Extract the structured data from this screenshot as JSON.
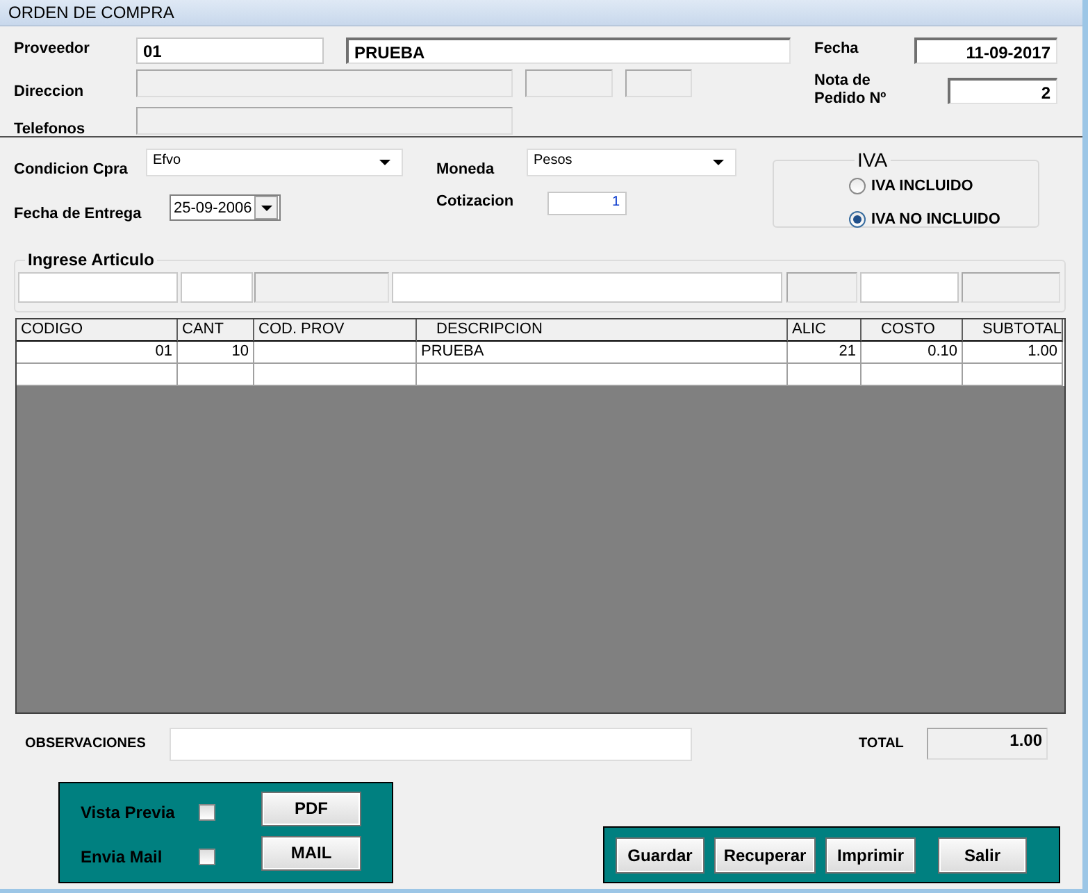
{
  "window": {
    "title": "ORDEN DE COMPRA"
  },
  "proveedor": {
    "label": "Proveedor",
    "code": "01",
    "name": "PRUEBA"
  },
  "fecha": {
    "label": "Fecha",
    "value": "11-09-2017"
  },
  "direccion": {
    "label": "Direccion",
    "fields": [
      {
        "disabled": true
      },
      {
        "disabled": true
      },
      {
        "disabled": true
      }
    ]
  },
  "nota_pedido": {
    "label": "Nota de Pedido Nº",
    "value": "2"
  },
  "telefonos": {
    "label": "Telefonos",
    "disabled": true
  },
  "condicion": {
    "label": "Condicion Cpra",
    "value": "Efvo"
  },
  "moneda": {
    "label": "Moneda",
    "value": "Pesos"
  },
  "fecha_entrega": {
    "label": "Fecha de Entrega",
    "value": "25-09-2006"
  },
  "cotizacion": {
    "label": "Cotizacion",
    "value": "1"
  },
  "iva": {
    "title": "IVA",
    "options": [
      {
        "label": "IVA INCLUIDO",
        "selected": false
      },
      {
        "label": "IVA NO INCLUIDO",
        "selected": true
      }
    ]
  },
  "ingrese_articulo": {
    "title": "Ingrese Articulo",
    "fields": [
      {
        "disabled": false
      },
      {
        "disabled": false
      },
      {
        "disabled": true
      },
      {
        "disabled": false
      },
      {
        "disabled": true
      },
      {
        "disabled": false
      },
      {
        "disabled": true
      }
    ]
  },
  "table": {
    "columns": [
      {
        "label": "CODIGO",
        "kind": "number"
      },
      {
        "label": "CANT",
        "kind": "number"
      },
      {
        "label": "COD. PROV",
        "kind": "text"
      },
      {
        "label": "DESCRIPCION",
        "kind": "text"
      },
      {
        "label": "ALIC",
        "kind": "number"
      },
      {
        "label": "COSTO",
        "kind": "number"
      },
      {
        "label": "SUBTOTAL",
        "kind": "number"
      }
    ],
    "rows": [
      [
        "01",
        "10",
        "",
        "PRUEBA",
        "21",
        "0.10",
        "1.00"
      ]
    ]
  },
  "observaciones": {
    "label": "OBSERVACIONES"
  },
  "total": {
    "label": "TOTAL",
    "value": "1.00"
  },
  "options": [
    {
      "label": "Vista Previa",
      "checked": false,
      "button": "PDF"
    },
    {
      "label": "Envia Mail",
      "checked": false,
      "button": "MAIL"
    }
  ],
  "actions": [
    "Guardar",
    "Recuperar",
    "Imprimir",
    "Salir"
  ]
}
